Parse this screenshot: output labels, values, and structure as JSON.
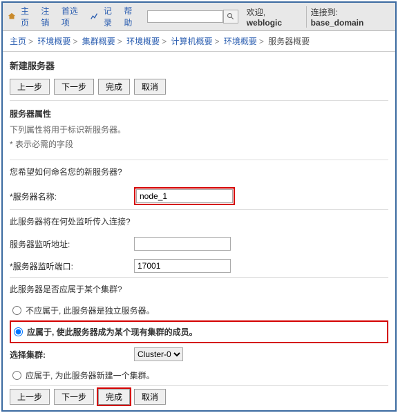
{
  "toolbar": {
    "home": "主页",
    "logout": "注销",
    "preferences": "首选项",
    "record": "记录",
    "help": "帮助",
    "search_placeholder": "",
    "welcome_prefix": "欢迎, ",
    "user": "weblogic",
    "connected_prefix": "连接到: ",
    "domain": "base_domain"
  },
  "breadcrumb": {
    "items": [
      "主页",
      "环境概要",
      "集群概要",
      "环境概要",
      "计算机概要",
      "环境概要"
    ],
    "current": "服务器概要"
  },
  "page": {
    "title": "新建服务器",
    "buttons": {
      "back": "上一步",
      "next": "下一步",
      "finish": "完成",
      "cancel": "取消"
    },
    "props_heading": "服务器属性",
    "props_desc": "下列属性将用于标识新服务器。",
    "required_note": "* 表示必需的字段",
    "q_name": "您希望如何命名您的新服务器?",
    "label_name": "*服务器名称:",
    "value_name": "node_1",
    "q_listen": "此服务器将在何处监听传入连接?",
    "label_addr": "服务器监听地址:",
    "value_addr": "",
    "label_port": "*服务器监听端口:",
    "value_port": "17001",
    "q_cluster": "此服务器是否应属于某个集群?",
    "radio_standalone": "不应属于, 此服务器是独立服务器。",
    "radio_existing": "应属于, 使此服务器成为某个现有集群的成员。",
    "label_select_cluster": "选择集群:",
    "cluster_options": [
      "Cluster-0"
    ],
    "cluster_selected": "Cluster-0",
    "radio_new": "应属于, 为此服务器新建一个集群。"
  }
}
